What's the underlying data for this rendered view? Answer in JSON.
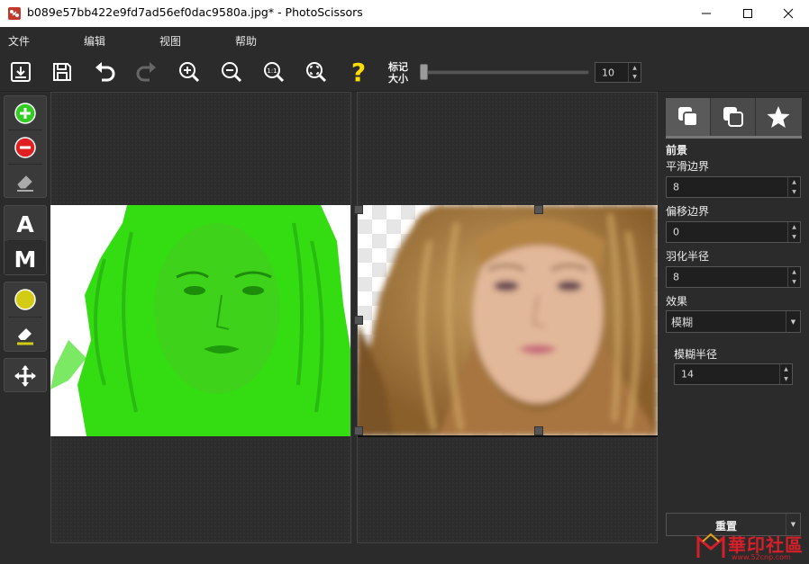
{
  "window": {
    "title": "b089e57bb422e9fd7ad56ef0dac9580a.jpg* - PhotoScissors",
    "minimize_icon": "minimize-icon",
    "maximize_icon": "maximize-icon",
    "close_icon": "close-icon"
  },
  "menu": {
    "items": [
      "文件",
      "编辑",
      "视图",
      "帮助"
    ]
  },
  "toolbar": {
    "buttons": [
      "open-icon",
      "save-icon",
      "undo-icon",
      "redo-icon",
      "zoom-in-icon",
      "zoom-out-icon",
      "zoom-actual-icon",
      "zoom-fit-icon",
      "help-icon"
    ],
    "marker_label_line1": "标记",
    "marker_label_line2": "大小",
    "marker_size_value": "10"
  },
  "left_tools": {
    "group1": [
      "add-foreground-marker-icon",
      "add-background-marker-icon",
      "eraser-icon"
    ],
    "group2": [
      "A",
      "M"
    ],
    "group3": [
      "color-picker-icon",
      "color-eraser-icon"
    ],
    "group4": [
      "move-icon"
    ]
  },
  "right_panel": {
    "tabs": [
      "foreground-tab-icon",
      "background-tab-icon",
      "favorites-tab-icon"
    ],
    "section_title": "前景",
    "smooth_edge_label": "平滑边界",
    "smooth_edge_value": "8",
    "offset_edge_label": "偏移边界",
    "offset_edge_value": "0",
    "feather_radius_label": "羽化半径",
    "feather_radius_value": "8",
    "effect_label": "效果",
    "effect_value": "模糊",
    "blur_radius_label": "模糊半径",
    "blur_radius_value": "14",
    "reset_label": "重置"
  },
  "watermark": {
    "text": "華印社區",
    "url": "www.52cnp.com"
  },
  "colors": {
    "accent_green": "#33cc22",
    "accent_red": "#e02020",
    "help_yellow": "#ffdd00"
  }
}
